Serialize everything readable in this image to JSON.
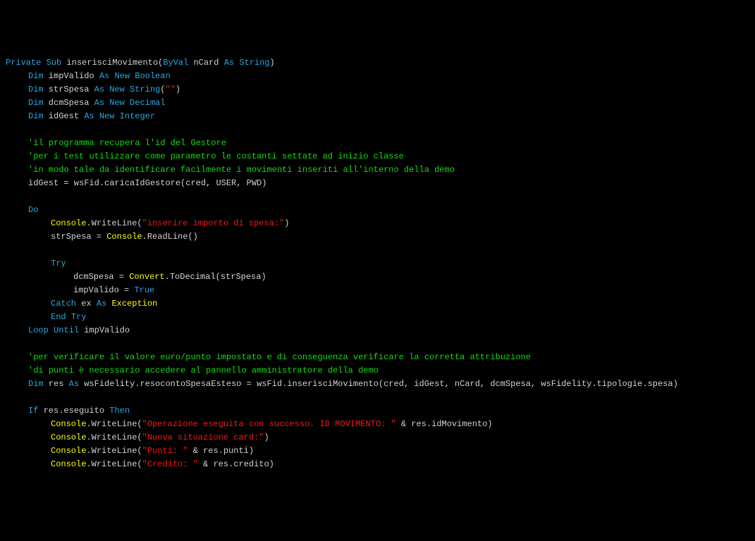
{
  "lines": [
    {
      "indent": 0,
      "tokens": [
        {
          "c": "kw",
          "t": "Private"
        },
        {
          "c": "",
          "t": " "
        },
        {
          "c": "kw",
          "t": "Sub"
        },
        {
          "c": "",
          "t": " inserisciMovimento("
        },
        {
          "c": "kw",
          "t": "ByVal"
        },
        {
          "c": "",
          "t": " nCard "
        },
        {
          "c": "kw",
          "t": "As"
        },
        {
          "c": "",
          "t": " "
        },
        {
          "c": "kw",
          "t": "String"
        },
        {
          "c": "",
          "t": ")"
        }
      ]
    },
    {
      "indent": 1,
      "tokens": [
        {
          "c": "kw",
          "t": "Dim"
        },
        {
          "c": "",
          "t": " impValido "
        },
        {
          "c": "kw",
          "t": "As"
        },
        {
          "c": "",
          "t": " "
        },
        {
          "c": "kw",
          "t": "New"
        },
        {
          "c": "",
          "t": " "
        },
        {
          "c": "kw",
          "t": "Boolean"
        }
      ]
    },
    {
      "indent": 1,
      "tokens": [
        {
          "c": "kw",
          "t": "Dim"
        },
        {
          "c": "",
          "t": " strSpesa "
        },
        {
          "c": "kw",
          "t": "As"
        },
        {
          "c": "",
          "t": " "
        },
        {
          "c": "kw",
          "t": "New"
        },
        {
          "c": "",
          "t": " "
        },
        {
          "c": "kw",
          "t": "String"
        },
        {
          "c": "",
          "t": "("
        },
        {
          "c": "str",
          "t": "\"\""
        },
        {
          "c": "",
          "t": ")"
        }
      ]
    },
    {
      "indent": 1,
      "tokens": [
        {
          "c": "kw",
          "t": "Dim"
        },
        {
          "c": "",
          "t": " dcmSpesa "
        },
        {
          "c": "kw",
          "t": "As"
        },
        {
          "c": "",
          "t": " "
        },
        {
          "c": "kw",
          "t": "New"
        },
        {
          "c": "",
          "t": " "
        },
        {
          "c": "kw",
          "t": "Decimal"
        }
      ]
    },
    {
      "indent": 1,
      "tokens": [
        {
          "c": "kw",
          "t": "Dim"
        },
        {
          "c": "",
          "t": " idGest "
        },
        {
          "c": "kw",
          "t": "As"
        },
        {
          "c": "",
          "t": " "
        },
        {
          "c": "kw",
          "t": "New"
        },
        {
          "c": "",
          "t": " "
        },
        {
          "c": "kw",
          "t": "Integer"
        }
      ]
    },
    {
      "indent": 0,
      "tokens": [
        {
          "c": "",
          "t": " "
        }
      ]
    },
    {
      "indent": 1,
      "tokens": [
        {
          "c": "cmt",
          "t": "'il programma recupera l'id del Gestore"
        }
      ]
    },
    {
      "indent": 1,
      "tokens": [
        {
          "c": "cmt",
          "t": "'per i test utilizzare come parametro le costanti settate ad inizio classe"
        }
      ]
    },
    {
      "indent": 1,
      "tokens": [
        {
          "c": "cmt",
          "t": "'in modo tale da identificare facilmente i movimenti inseriti all'interno della demo"
        }
      ]
    },
    {
      "indent": 1,
      "tokens": [
        {
          "c": "",
          "t": "idGest = wsFid.caricaIdGestore(cred, USER, PWD)"
        }
      ]
    },
    {
      "indent": 0,
      "tokens": [
        {
          "c": "",
          "t": " "
        }
      ]
    },
    {
      "indent": 1,
      "tokens": [
        {
          "c": "kw",
          "t": "Do"
        }
      ]
    },
    {
      "indent": 2,
      "tokens": [
        {
          "c": "id",
          "t": "Console"
        },
        {
          "c": "",
          "t": ".WriteLine("
        },
        {
          "c": "str",
          "t": "\"inserire importo di spesa:\""
        },
        {
          "c": "",
          "t": ")"
        }
      ]
    },
    {
      "indent": 2,
      "tokens": [
        {
          "c": "",
          "t": "strSpesa = "
        },
        {
          "c": "id",
          "t": "Console"
        },
        {
          "c": "",
          "t": ".ReadLine()"
        }
      ]
    },
    {
      "indent": 0,
      "tokens": [
        {
          "c": "",
          "t": " "
        }
      ]
    },
    {
      "indent": 2,
      "tokens": [
        {
          "c": "kw",
          "t": "Try"
        }
      ]
    },
    {
      "indent": 3,
      "tokens": [
        {
          "c": "",
          "t": "dcmSpesa = "
        },
        {
          "c": "id",
          "t": "Convert"
        },
        {
          "c": "",
          "t": ".ToDecimal(strSpesa)"
        }
      ]
    },
    {
      "indent": 3,
      "tokens": [
        {
          "c": "",
          "t": "impValido = "
        },
        {
          "c": "kw",
          "t": "True"
        }
      ]
    },
    {
      "indent": 2,
      "tokens": [
        {
          "c": "kw",
          "t": "Catch"
        },
        {
          "c": "",
          "t": " ex "
        },
        {
          "c": "kw",
          "t": "As"
        },
        {
          "c": "",
          "t": " "
        },
        {
          "c": "id",
          "t": "Exception"
        }
      ]
    },
    {
      "indent": 2,
      "tokens": [
        {
          "c": "kw",
          "t": "End"
        },
        {
          "c": "",
          "t": " "
        },
        {
          "c": "kw",
          "t": "Try"
        }
      ]
    },
    {
      "indent": 1,
      "tokens": [
        {
          "c": "kw",
          "t": "Loop"
        },
        {
          "c": "",
          "t": " "
        },
        {
          "c": "kw",
          "t": "Until"
        },
        {
          "c": "",
          "t": " impValido"
        }
      ]
    },
    {
      "indent": 0,
      "tokens": [
        {
          "c": "",
          "t": " "
        }
      ]
    },
    {
      "indent": 1,
      "tokens": [
        {
          "c": "cmt",
          "t": "'per verificare il valore euro/punto impostato e di conseguenza verificare la corretta attribuzione"
        }
      ]
    },
    {
      "indent": 1,
      "tokens": [
        {
          "c": "cmt",
          "t": "'di punti è necessario accedere al pannello amministratore della demo"
        }
      ]
    },
    {
      "indent": 1,
      "tokens": [
        {
          "c": "kw",
          "t": "Dim"
        },
        {
          "c": "",
          "t": " res "
        },
        {
          "c": "kw",
          "t": "As"
        },
        {
          "c": "",
          "t": " wsFidelity.resocontoSpesaEsteso = wsFid.inserisciMovimento(cred, idGest, nCard, dcmSpesa, wsFidelity.tipologie.spesa)"
        }
      ]
    },
    {
      "indent": 0,
      "tokens": [
        {
          "c": "",
          "t": " "
        }
      ]
    },
    {
      "indent": 1,
      "tokens": [
        {
          "c": "kw",
          "t": "If"
        },
        {
          "c": "",
          "t": " res.eseguito "
        },
        {
          "c": "kw",
          "t": "Then"
        }
      ]
    },
    {
      "indent": 2,
      "tokens": [
        {
          "c": "id",
          "t": "Console"
        },
        {
          "c": "",
          "t": ".WriteLine("
        },
        {
          "c": "str",
          "t": "\"Operazione eseguita con successo. ID MOVIMENTO: \""
        },
        {
          "c": "",
          "t": " & res.idMovimento)"
        }
      ]
    },
    {
      "indent": 2,
      "tokens": [
        {
          "c": "id",
          "t": "Console"
        },
        {
          "c": "",
          "t": ".WriteLine("
        },
        {
          "c": "str",
          "t": "\"Nuova situazione card:\""
        },
        {
          "c": "",
          "t": ")"
        }
      ]
    },
    {
      "indent": 2,
      "tokens": [
        {
          "c": "id",
          "t": "Console"
        },
        {
          "c": "",
          "t": ".WriteLine("
        },
        {
          "c": "str",
          "t": "\"Punti: \""
        },
        {
          "c": "",
          "t": " & res.punti)"
        }
      ]
    },
    {
      "indent": 2,
      "tokens": [
        {
          "c": "id",
          "t": "Console"
        },
        {
          "c": "",
          "t": ".WriteLine("
        },
        {
          "c": "str",
          "t": "\"Credito: \""
        },
        {
          "c": "",
          "t": " & res.credito)"
        }
      ]
    }
  ]
}
